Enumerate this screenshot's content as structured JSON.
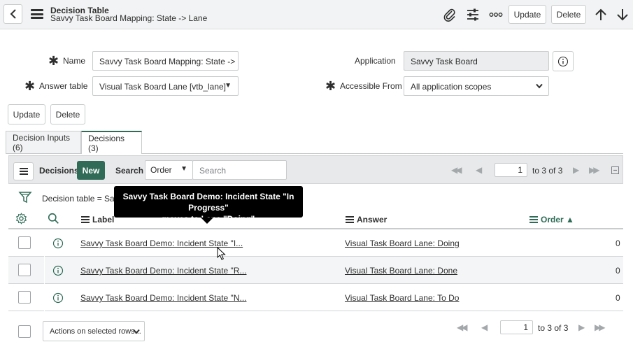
{
  "header": {
    "title": "Decision Table",
    "subtitle": "Savvy Task Board Mapping: State -> Lane",
    "update_label": "Update",
    "delete_label": "Delete"
  },
  "form": {
    "name_label": "Name",
    "name_value": "Savvy Task Board Mapping: State -> Lan",
    "answer_table_label": "Answer table",
    "answer_table_value": "Visual Task Board Lane [vtb_lane]",
    "application_label": "Application",
    "application_value": "Savvy Task Board",
    "accessible_from_label": "Accessible From",
    "accessible_from_value": "All application scopes",
    "update_label": "Update",
    "delete_label": "Delete"
  },
  "tabs": [
    {
      "label": "Decision Inputs (6)",
      "active": false
    },
    {
      "label": "Decisions (3)",
      "active": true
    }
  ],
  "list": {
    "title": "Decisions",
    "new_label": "New",
    "search_label": "Search",
    "search_field": "Order",
    "search_placeholder": "Search",
    "page_value": "1",
    "page_of": "to 3 of 3",
    "filter_text": "Decision table = Savv",
    "columns": {
      "label": "Label",
      "answer": "Answer",
      "order": "Order ▲"
    },
    "rows": [
      {
        "label": "Savvy Task Board Demo: Incident State \"I...",
        "answer": "Visual Task Board Lane: Doing",
        "order": "0"
      },
      {
        "label": "Savvy Task Board Demo: Incident State \"R...",
        "answer": "Visual Task Board Lane: Done",
        "order": "0"
      },
      {
        "label": "Savvy Task Board Demo: Incident State \"N...",
        "answer": "Visual Task Board Lane: To Do",
        "order": "0"
      }
    ],
    "actions_label": "Actions on selected rows...",
    "footer_page_value": "1",
    "footer_page_of": "to 3 of 3"
  },
  "tooltip": {
    "line1": "Savvy Task Board Demo: Incident State \"In Progress\"",
    "line2": "moves to Lane \"Doing\""
  },
  "colors": {
    "accent": "#2f6b57",
    "header_bg": "#f2f3f4",
    "tooltip_bg": "#000000"
  },
  "icons": [
    "chevron-left-icon",
    "hamburger-icon",
    "paperclip-icon",
    "sliders-icon",
    "more-icon",
    "arrow-up-icon",
    "arrow-down-icon",
    "info-icon",
    "funnel-icon",
    "gear-icon",
    "search-icon",
    "pointer-cursor-icon"
  ]
}
